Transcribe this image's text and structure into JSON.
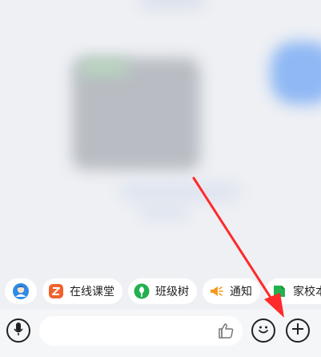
{
  "quick_actions": [
    {
      "label": "",
      "icon": "avatar-icon"
    },
    {
      "label": "在线课堂",
      "icon": "online-class-icon",
      "color": "#f0622d"
    },
    {
      "label": "班级树",
      "icon": "class-tree-icon",
      "color": "#23b04f"
    },
    {
      "label": "通知",
      "icon": "megaphone-icon",
      "color": "#f39b1e"
    },
    {
      "label": "家校本",
      "icon": "home-school-book-icon",
      "color": "#23b04f"
    }
  ],
  "input_bar": {
    "text_placeholder": "",
    "voice_icon": "microphone-icon",
    "like_icon": "thumbs-up-icon",
    "emoji_icon": "emoji-icon",
    "more_icon": "plus-icon"
  },
  "annotation": {
    "color": "#ff2a2a"
  }
}
